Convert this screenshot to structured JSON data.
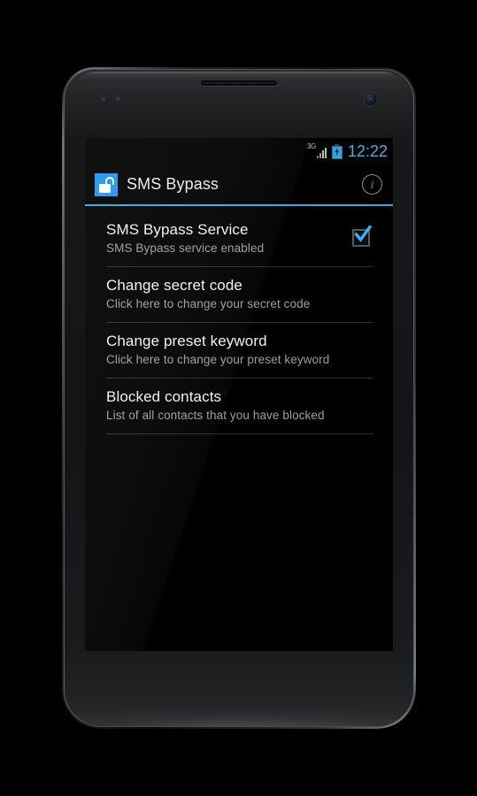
{
  "device": {
    "name": "android-phone-mockup",
    "earpiece": "earpiece-speaker",
    "camera": "front-camera"
  },
  "status_bar": {
    "network_label": "3G",
    "network_icon": "signal-bars-icon",
    "battery_icon": "battery-charging-icon",
    "time": "12:22",
    "time_color": "#3ab3e8"
  },
  "title_bar": {
    "app_icon": "open-padlock-icon",
    "title": "SMS Bypass",
    "info_label": "i",
    "info_icon": "info-circle-icon",
    "accent_color": "#2dabe3",
    "logo_color": "#2196f3"
  },
  "list": {
    "items": [
      {
        "title": "SMS Bypass Service",
        "subtitle": "SMS Bypass service enabled",
        "has_checkbox": true,
        "checked": true,
        "check_color": "#29b6f6"
      },
      {
        "title": "Change secret code",
        "subtitle": "Click here to change your secret code",
        "has_checkbox": false,
        "checked": false
      },
      {
        "title": "Change preset keyword",
        "subtitle": "Click here to change your preset keyword",
        "has_checkbox": false,
        "checked": false
      },
      {
        "title": "Blocked contacts",
        "subtitle": "List of all contacts that you have blocked",
        "has_checkbox": false,
        "checked": false
      }
    ]
  }
}
